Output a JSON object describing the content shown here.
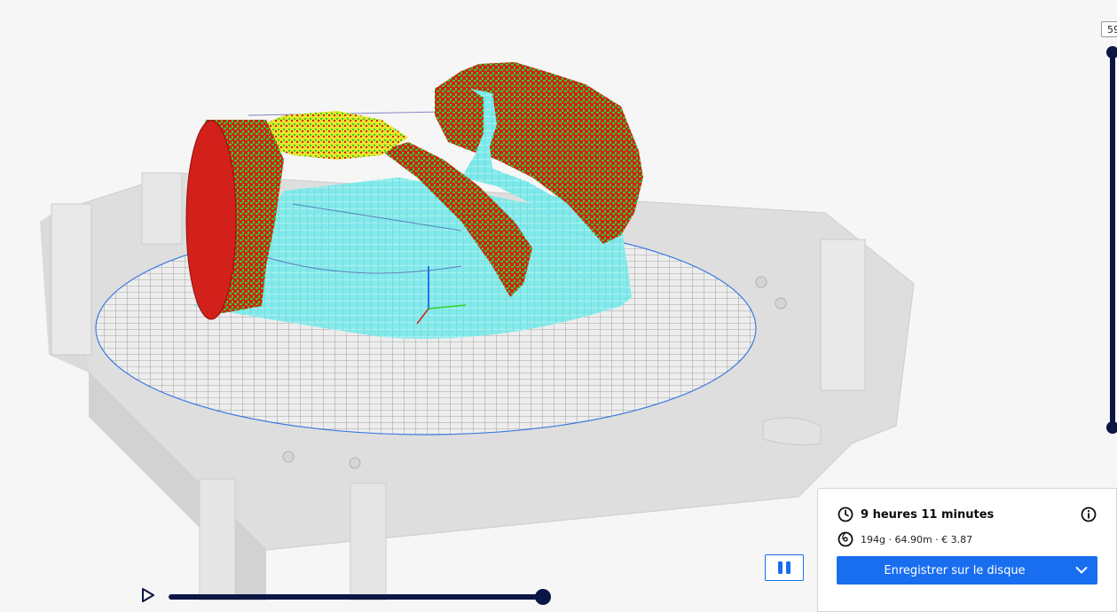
{
  "layer_slider": {
    "current_layer": "59"
  },
  "print_info": {
    "duration": "9 heures 11 minutes",
    "material": "194g · 64.90m · € 3.87"
  },
  "actions": {
    "save_label": "Enregistrer sur le disque"
  },
  "colors": {
    "accent": "#196ef0",
    "slider": "#0c1645",
    "wall_outer": "#d2201a",
    "wall_inner": "#2fd12a",
    "skin": "#e5e52a",
    "support": "#7ee9ea",
    "travel": "#3b3ba0"
  },
  "icons": {
    "clock": "clock-icon",
    "filament": "filament-spool-icon",
    "info": "info-icon",
    "chevron": "chevron-down-icon",
    "play": "play-icon",
    "pause": "pause-icon"
  }
}
